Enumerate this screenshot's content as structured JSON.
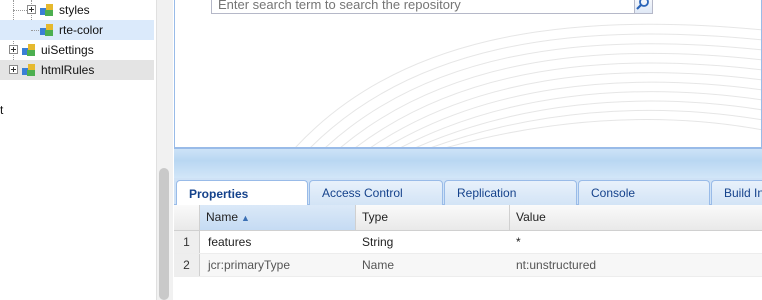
{
  "tree": {
    "items": [
      {
        "label": "styles"
      },
      {
        "label": "rte-color"
      },
      {
        "label": "uiSettings"
      },
      {
        "label": "htmlRules"
      }
    ],
    "stray_text": "t"
  },
  "search": {
    "placeholder": "Enter search term to search the repository"
  },
  "tabs": [
    {
      "label": "Properties"
    },
    {
      "label": "Access Control"
    },
    {
      "label": "Replication"
    },
    {
      "label": "Console"
    },
    {
      "label": "Build In"
    }
  ],
  "grid": {
    "columns": [
      {
        "label": "Name"
      },
      {
        "label": "Type"
      },
      {
        "label": "Value"
      }
    ],
    "rows": [
      {
        "num": "1",
        "name": "features",
        "type": "String",
        "value": "*"
      },
      {
        "num": "2",
        "name": "jcr:primaryType",
        "type": "Name",
        "value": "nt:unstructured"
      }
    ]
  },
  "colors": {
    "accent": "#15428b",
    "tab_bar": "#cfe2f6",
    "selected_row": "#dbeafb"
  }
}
